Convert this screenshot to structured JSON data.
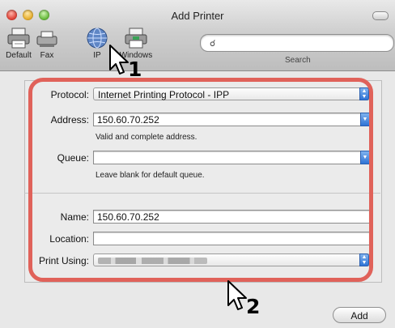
{
  "window": {
    "title": "Add Printer"
  },
  "toolbar": {
    "items": [
      {
        "label": "Default"
      },
      {
        "label": "Fax"
      },
      {
        "label": "IP"
      },
      {
        "label": "Windows"
      }
    ],
    "search": {
      "label": "Search",
      "placeholder": ""
    }
  },
  "form": {
    "protocol": {
      "label": "Protocol:",
      "value": "Internet Printing Protocol - IPP"
    },
    "address": {
      "label": "Address:",
      "value": "150.60.70.252",
      "hint": "Valid and complete address."
    },
    "queue": {
      "label": "Queue:",
      "value": "",
      "hint": "Leave blank for default queue."
    },
    "name": {
      "label": "Name:",
      "value": "150.60.70.252"
    },
    "location": {
      "label": "Location:",
      "value": ""
    },
    "print_using": {
      "label": "Print Using:",
      "value": ""
    }
  },
  "buttons": {
    "add": "Add"
  },
  "annotations": {
    "step1": "1",
    "step2": "2",
    "highlight_color": "#e0625a"
  }
}
